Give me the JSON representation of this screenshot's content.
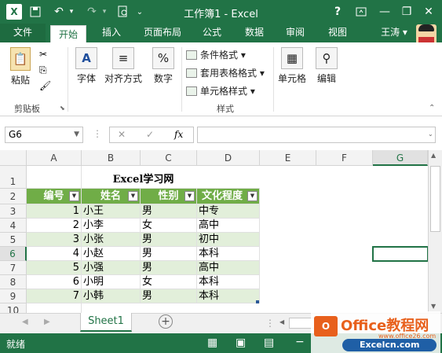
{
  "window": {
    "title": "工作簿1 - Excel",
    "help": "?",
    "minimize": "—",
    "restore": "❐",
    "close": "✕"
  },
  "qat": {
    "undo": "↶",
    "redo": "↷"
  },
  "tabs": [
    {
      "label": "文件"
    },
    {
      "label": "开始"
    },
    {
      "label": "插入"
    },
    {
      "label": "页面布局"
    },
    {
      "label": "公式"
    },
    {
      "label": "数据"
    },
    {
      "label": "审阅"
    },
    {
      "label": "视图"
    }
  ],
  "user": {
    "name": "王涛"
  },
  "ribbon": {
    "paste": "粘贴",
    "clipboard_group": "剪贴板",
    "font": "字体",
    "alignment": "对齐方式",
    "number": "数字",
    "cond_format": "条件格式",
    "table_format": "套用表格格式",
    "cell_style": "单元格样式",
    "styles_group": "样式",
    "cells": "单元格",
    "editing": "编辑"
  },
  "formula_bar": {
    "name_box": "G6",
    "fx": "fx",
    "formula": ""
  },
  "columns": [
    "A",
    "B",
    "C",
    "D",
    "E",
    "F",
    "G"
  ],
  "rows": [
    "1",
    "2",
    "3",
    "4",
    "5",
    "6",
    "7",
    "8",
    "9",
    "10"
  ],
  "sheet": {
    "title": "Excel学习网",
    "headers": [
      "编号",
      "姓名",
      "性别",
      "文化程度"
    ],
    "data": [
      [
        "1",
        "小王",
        "男",
        "中专"
      ],
      [
        "2",
        "小李",
        "女",
        "高中"
      ],
      [
        "3",
        "小张",
        "男",
        "初中"
      ],
      [
        "4",
        "小赵",
        "男",
        "本科"
      ],
      [
        "5",
        "小强",
        "男",
        "高中"
      ],
      [
        "6",
        "小明",
        "女",
        "本科"
      ],
      [
        "7",
        "小韩",
        "男",
        "本科"
      ]
    ]
  },
  "sheet_tabs": [
    {
      "label": "Sheet1"
    }
  ],
  "status": {
    "text": "就绪"
  },
  "watermark": {
    "line1": "Office教程网",
    "line2": "www.office26.com",
    "line3": "Excelcn.com"
  },
  "colors": {
    "accent": "#217346",
    "table_header": "#70ad47",
    "band": "#e2efda"
  }
}
